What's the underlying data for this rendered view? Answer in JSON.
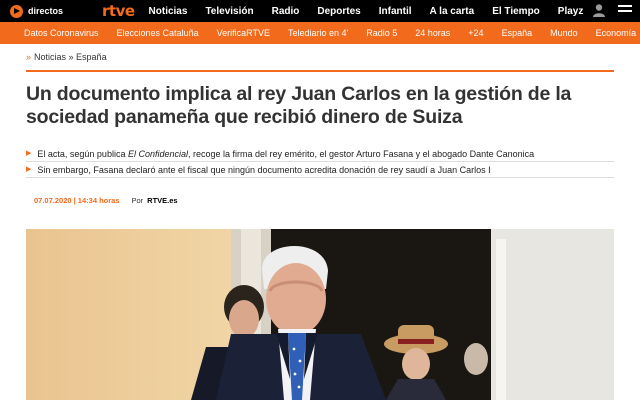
{
  "topbar": {
    "directos_label": "directos",
    "logo": "rtve",
    "nav": [
      "Noticias",
      "Televisión",
      "Radio",
      "Deportes",
      "Infantil",
      "A la carta",
      "El Tiempo",
      "Playz"
    ]
  },
  "subnav": {
    "items": [
      "Datos Coronavirus",
      "Elecciones Cataluña",
      "VerificaRTVE",
      "Telediario en 4'",
      "Radio 5",
      "24 horas",
      "+24",
      "España",
      "Mundo",
      "Economía"
    ]
  },
  "breadcrumb": [
    "Noticias",
    "España"
  ],
  "article": {
    "headline": "Un documento implica al rey Juan Carlos en la gestión de la sociedad panameña que recibió dinero de Suiza",
    "summary": [
      {
        "before": "El acta, según publica ",
        "italic": "El Confidencial",
        "after": ", recoge la firma del rey emérito, el gestor Arturo Fasana y el abogado Dante Canonica"
      },
      {
        "before": "Sin embargo, Fasana declaró ante el fiscal que ningún documento acredita donación de rey saudí a Juan Carlos I",
        "italic": "",
        "after": ""
      }
    ],
    "date": "07.07.2020 | 14:34 horas",
    "by_label": "Por",
    "source": "RTVE.es"
  },
  "colors": {
    "accent": "#f26a1b",
    "topbar": "#000000",
    "headline": "#333333"
  }
}
